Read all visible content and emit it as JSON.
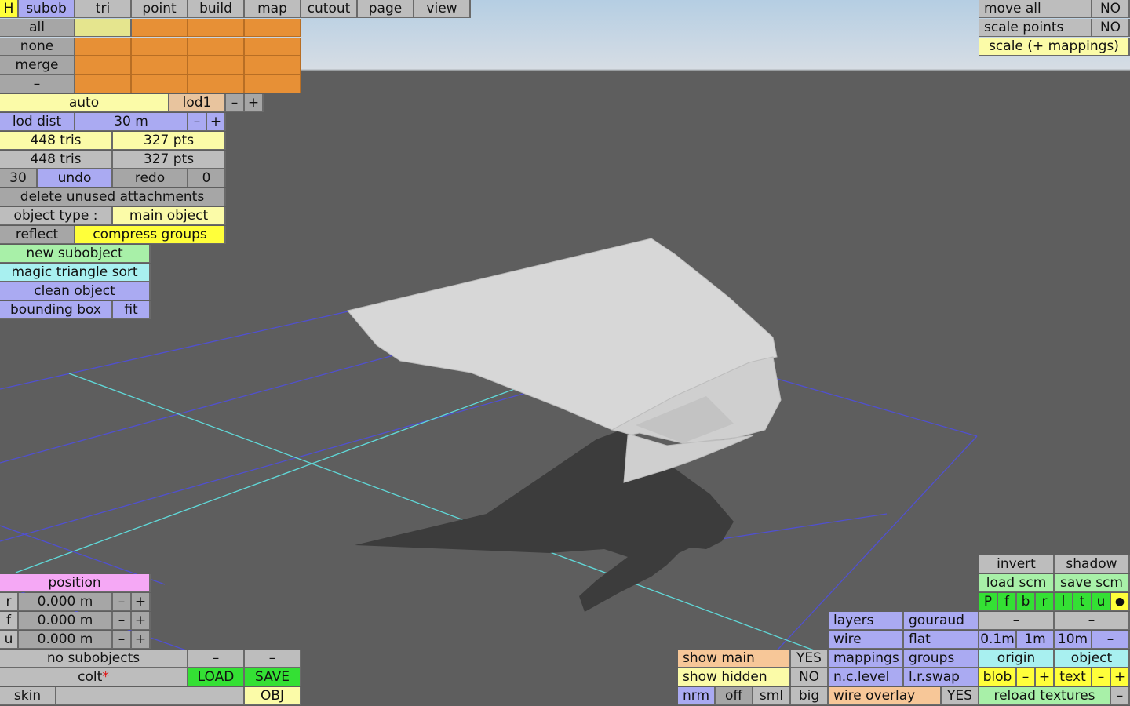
{
  "tabs": [
    "H",
    "subob",
    "tri",
    "point",
    "build",
    "map",
    "cutout",
    "page",
    "view"
  ],
  "select": {
    "all": "all",
    "none": "none",
    "merge": "merge",
    "minus": "–"
  },
  "lod": {
    "auto": "auto",
    "lod1": "lod1",
    "minus": "–",
    "plus": "+",
    "dist_label": "lod dist",
    "dist_value": "30 m"
  },
  "stats": {
    "tris1": "448 tris",
    "pts1": "327 pts",
    "tris2": "448 tris",
    "pts2": "327 pts"
  },
  "undo": {
    "count": "30",
    "undo": "undo",
    "redo": "redo",
    "redo_count": "0"
  },
  "tools": {
    "delete_unused": "delete unused attachments",
    "object_type_label": "object type :",
    "object_type_value": "main object",
    "reflect": "reflect",
    "compress": "compress groups",
    "new_subobject": "new subobject",
    "magic_sort": "magic triangle sort",
    "clean_object": "clean object",
    "bounding_box": "bounding box",
    "fit": "fit"
  },
  "topright": {
    "move_all": "move all",
    "move_all_value": "NO",
    "scale_points": "scale points",
    "scale_points_value": "NO",
    "scale_mappings": "scale (+ mappings)"
  },
  "position": {
    "title": "position",
    "rows": [
      {
        "axis": "r",
        "value": "0.000 m"
      },
      {
        "axis": "f",
        "value": "0.000 m"
      },
      {
        "axis": "u",
        "value": "0.000 m"
      }
    ],
    "minus": "–",
    "plus": "+"
  },
  "subobjects": {
    "label": "no subobjects",
    "minus": "–"
  },
  "file": {
    "name": "colt",
    "asterisk": "*",
    "load": "LOAD",
    "save": "SAVE",
    "skin": "skin",
    "obj": "OBJ"
  },
  "show": {
    "main": "show main",
    "main_value": "YES",
    "hidden": "show hidden",
    "hidden_value": "NO",
    "nrm": "nrm",
    "off": "off",
    "sml": "sml",
    "big": "big"
  },
  "render": {
    "layers": "layers",
    "gouraud": "gouraud",
    "wire": "wire",
    "flat": "flat",
    "mappings": "mappings",
    "groups": "groups",
    "nclevel": "n.c.level",
    "lrswap": "l.r.swap",
    "wire_overlay": "wire overlay",
    "wire_overlay_value": "YES"
  },
  "scm": {
    "invert": "invert",
    "shadow": "shadow",
    "load_scm": "load scm",
    "save_scm": "save scm",
    "letters": [
      "P",
      "f",
      "b",
      "r",
      "l",
      "t",
      "u"
    ],
    "dot": "●",
    "dash": "–",
    "grid": [
      "0.1m",
      "1m",
      "10m"
    ],
    "origin": "origin",
    "object": "object",
    "blob": "blob",
    "text": "text",
    "minus": "–",
    "plus": "+",
    "reload": "reload textures"
  },
  "colors": {
    "ground": "#5e5e5e",
    "sky": "#b5cee3",
    "panel_gray": "#bdbdbd",
    "panel_blue": "#aaaaf2",
    "panel_yellow": "#fbfba8",
    "panel_green": "#a8f0a8",
    "save_green": "#34e034",
    "orange": "#e79036",
    "wire_blue": "#5050d0",
    "wire_cyan": "#60d8d8",
    "model": "#d8d8d8",
    "shadow": "#3c3c3c"
  }
}
